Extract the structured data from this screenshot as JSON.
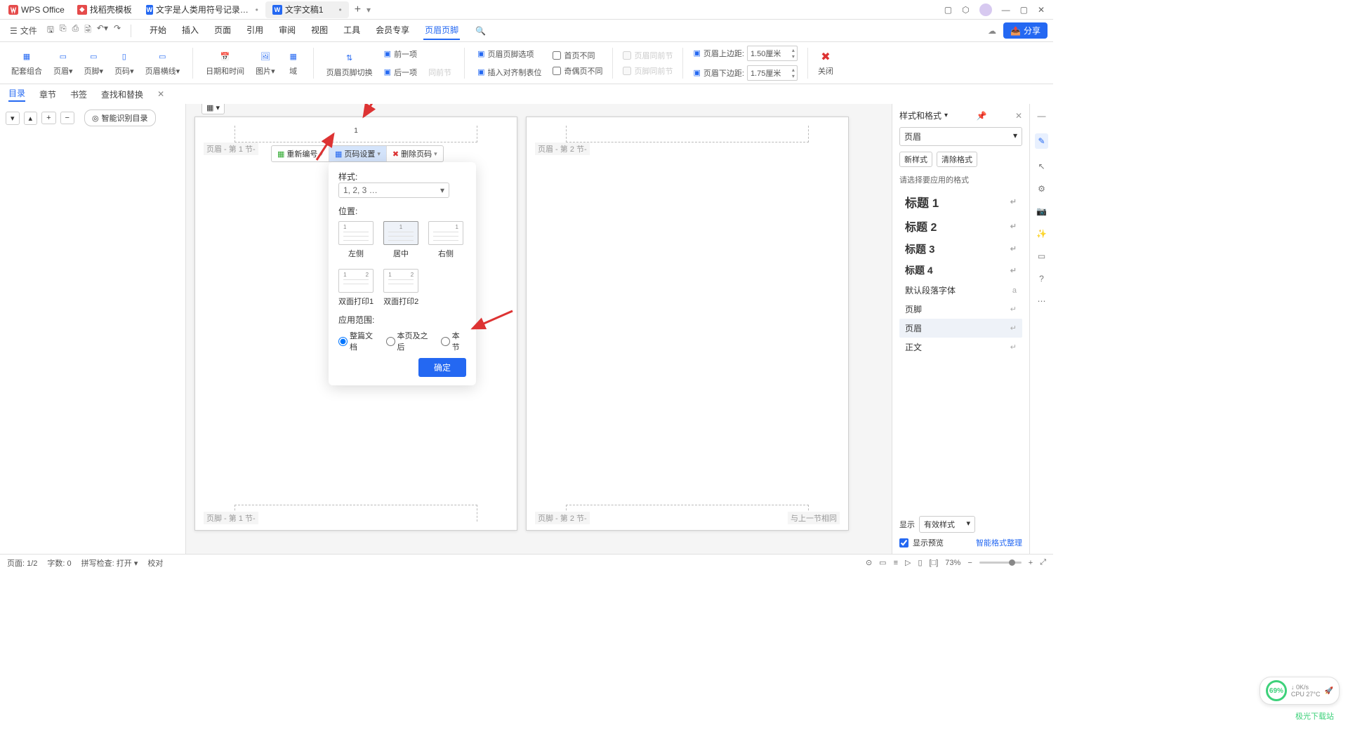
{
  "app_name": "WPS Office",
  "tabs": [
    {
      "icon_bg": "#e54b4b",
      "icon_txt": "",
      "label": "找稻壳模板"
    },
    {
      "icon_bg": "#2468f2",
      "icon_txt": "W",
      "label": "文字是人类用符号记录表达信息以…",
      "dirty": true
    },
    {
      "icon_bg": "#2468f2",
      "icon_txt": "W",
      "label": "文字文稿1",
      "dirty": true,
      "active": true
    }
  ],
  "menu": {
    "file": "文件",
    "ribbon": [
      "开始",
      "插入",
      "页面",
      "引用",
      "审阅",
      "视图",
      "工具",
      "会员专享",
      "页眉页脚"
    ],
    "active_ribbon": "页眉页脚",
    "share": "分享"
  },
  "ribbon": {
    "group1": [
      "配套组合",
      "页眉",
      "页脚",
      "页码",
      "页眉横线"
    ],
    "group2": [
      "日期和时间",
      "图片",
      "域"
    ],
    "switch_btn": "页眉页脚切换",
    "prev": "前一项",
    "next": "后一项",
    "same_prev": "同前节",
    "opts_label": "页眉页脚选项",
    "align_label": "插入对齐制表位",
    "chk_first": "首页不同",
    "chk_oddeven": "奇偶页不同",
    "chk_hdr_same": "页眉同前节",
    "chk_ftr_same": "页脚同前节",
    "hdr_top_lbl": "页眉上边距:",
    "hdr_top_val": "1.50厘米",
    "hdr_bot_lbl": "页眉下边距:",
    "hdr_bot_val": "1.75厘米",
    "close": "关闭"
  },
  "subnav": {
    "items": [
      "目录",
      "章节",
      "书签",
      "查找和替换"
    ],
    "active": "目录",
    "smart": "智能识别目录"
  },
  "page_labels": {
    "hdr1": "页眉 - 第 1 节-",
    "ftr1": "页脚 - 第 1 节-",
    "hdr2": "页眉 - 第 2 节-",
    "ftr2": "页脚 - 第 2 节-",
    "same_prev": "与上一节相同",
    "pgnum1": "1"
  },
  "page_toolbar": {
    "renumber": "重新编号",
    "settings": "页码设置",
    "delete": "删除页码"
  },
  "popup": {
    "style_label": "样式:",
    "style_value": "1, 2, 3 …",
    "pos_label": "位置:",
    "positions": [
      "左侧",
      "居中",
      "右侧",
      "双面打印1",
      "双面打印2"
    ],
    "scope_label": "应用范围:",
    "scopes": [
      "整篇文档",
      "本页及之后",
      "本节"
    ],
    "ok": "确定"
  },
  "rightpanel": {
    "title": "样式和格式",
    "current": "页眉",
    "new_style": "新样式",
    "clear_fmt": "清除格式",
    "hint": "请选择要应用的格式",
    "styles": [
      "标题 1",
      "标题 2",
      "标题 3",
      "标题 4",
      "默认段落字体",
      "页脚",
      "页眉",
      "正文"
    ],
    "show": "显示",
    "show_val": "有效样式",
    "preview": "显示预览",
    "smart_fmt": "智能格式整理"
  },
  "status": {
    "page": "页面: 1/2",
    "words": "字数: 0",
    "spell": "拼写检查: 打开",
    "proof": "校对",
    "zoom": "73%"
  },
  "perf": {
    "pct": "69%",
    "net": "0K/s",
    "cpu": "CPU 27°C"
  },
  "watermark": "极光下载站"
}
